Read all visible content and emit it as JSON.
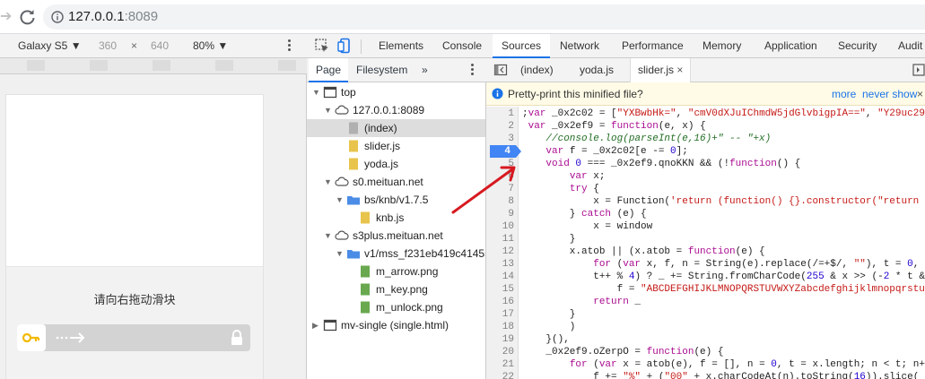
{
  "browser": {
    "url_host": "127.0.0.1",
    "url_port": ":8089"
  },
  "device_toolbar": {
    "device_name": "Galaxy S5 ▼",
    "width": "360",
    "times": "×",
    "height": "640",
    "zoom": "80% ▼"
  },
  "page": {
    "captcha_title": "请向右拖动滑块"
  },
  "devtools": {
    "tabs": [
      "Elements",
      "Console",
      "Sources",
      "Network",
      "Performance",
      "Memory",
      "Application",
      "Security",
      "Audit"
    ],
    "active_tab": "Sources",
    "nav_subtabs": [
      "Page",
      "Filesystem",
      "»"
    ],
    "tree": [
      {
        "label": "top",
        "icon": "frame-icon"
      },
      {
        "label": "127.0.0.1:8089",
        "icon": "cloud-icon"
      },
      {
        "label": "(index)",
        "icon": "file-icon-grey"
      },
      {
        "label": "slider.js",
        "icon": "file-icon-yellow"
      },
      {
        "label": "yoda.js",
        "icon": "file-icon-yellow"
      },
      {
        "label": "s0.meituan.net",
        "icon": "cloud-icon"
      },
      {
        "label": "bs/knb/v1.7.5",
        "icon": "folder-icon"
      },
      {
        "label": "knb.js",
        "icon": "file-icon-yellow"
      },
      {
        "label": "s3plus.meituan.net",
        "icon": "cloud-icon"
      },
      {
        "label": "v1/mss_f231eb419c414559",
        "icon": "folder-icon"
      },
      {
        "label": "m_arrow.png",
        "icon": "file-icon-green"
      },
      {
        "label": "m_key.png",
        "icon": "file-icon-green"
      },
      {
        "label": "m_unlock.png",
        "icon": "file-icon-green"
      },
      {
        "label": "mv-single (single.html)",
        "icon": "frame-icon"
      }
    ],
    "file_tabs": [
      "(index)",
      "yoda.js",
      "slider.js"
    ],
    "close_glyph": "×",
    "infobar": {
      "message": "Pretty-print this minified file?",
      "more": "more",
      "never_show": "never show",
      "close": "×"
    },
    "breakpoint_line": 4,
    "code_lines": [
      {
        "n": "1",
        "t": ";var _0x2c02 = [\"YXBwbHk=\", \"cmV0dXJuIChmdW5jdGlvbigpIA==\", \"Y29uc29"
      },
      {
        "n": "2",
        "t": " var _0x2ef9 = function(e, x) {"
      },
      {
        "n": "3",
        "t": "    //console.log(parseInt(e,16)+\" -- \"+x)"
      },
      {
        "n": "4",
        "t": "    var f = _0x2c02[e -= 0];"
      },
      {
        "n": "5",
        "t": "    void 0 === _0x2ef9.qnoKKN && (!function() {"
      },
      {
        "n": "6",
        "t": "        var x;"
      },
      {
        "n": "7",
        "t": "        try {"
      },
      {
        "n": "8",
        "t": "            x = Function('return (function() {}.constructor(\"return"
      },
      {
        "n": "9",
        "t": "        } catch (e) {"
      },
      {
        "n": "10",
        "t": "            x = window"
      },
      {
        "n": "11",
        "t": "        }"
      },
      {
        "n": "12",
        "t": "        x.atob || (x.atob = function(e) {"
      },
      {
        "n": "13",
        "t": "            for (var x, f, n = String(e).replace(/=+$/, \"\"), t = 0,"
      },
      {
        "n": "14",
        "t": "            t++ % 4) ? _ += String.fromCharCode(255 & x >> (-2 * t &"
      },
      {
        "n": "15",
        "t": "                f = \"ABCDEFGHIJKLMNOPQRSTUVWXYZabcdefghijklmnopqrstu"
      },
      {
        "n": "16",
        "t": "            return _"
      },
      {
        "n": "17",
        "t": "        }"
      },
      {
        "n": "18",
        "t": "        )"
      },
      {
        "n": "19",
        "t": "    }(),"
      },
      {
        "n": "20",
        "t": "    _0x2ef9.oZerpO = function(e) {"
      },
      {
        "n": "21",
        "t": "        for (var x = atob(e), f = [], n = 0, t = x.length; n < t; n+"
      },
      {
        "n": "22",
        "t": "            f += \"%\" + (\"00\" + x.charCodeAt(n).toString(16)).slice("
      }
    ]
  },
  "colors": {
    "accent": "#1a73e8",
    "breakpoint": "#4285f4",
    "annotation": "#d71920"
  }
}
